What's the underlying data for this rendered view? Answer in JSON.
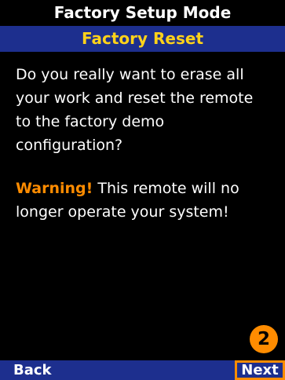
{
  "header": {
    "mode": "Factory Setup Mode",
    "title": "Factory Reset"
  },
  "body": {
    "question": "Do you really want to erase all your work and reset the remote to the factory demo configuration?",
    "warning_label": "Warning!",
    "warning_text": " This remote will no longer operate your system!"
  },
  "step_badge": "2",
  "softkeys": {
    "back": "Back",
    "next": "Next"
  },
  "colors": {
    "title_bar_bg": "#1d2f8e",
    "title_text": "#ffd21a",
    "warning": "#ff8c00",
    "highlight": "#ff8c00"
  }
}
